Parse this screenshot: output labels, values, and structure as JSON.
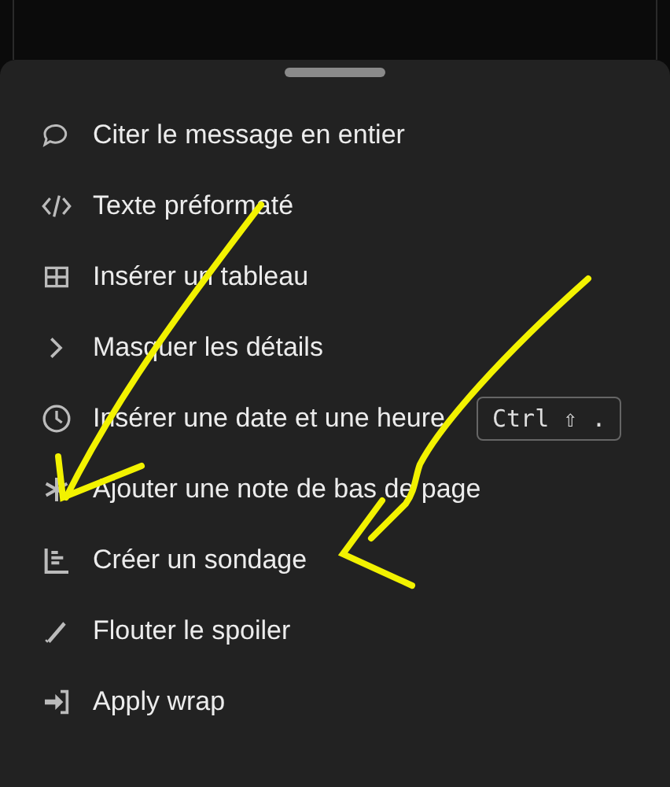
{
  "menu": {
    "items": [
      {
        "label": "Citer le message en entier"
      },
      {
        "label": "Texte préformaté"
      },
      {
        "label": "Insérer un tableau"
      },
      {
        "label": "Masquer les détails"
      },
      {
        "label": "Insérer une date et une heure",
        "shortcut": "Ctrl ⇧ ."
      },
      {
        "label": "Ajouter une note de bas de page"
      },
      {
        "label": "Créer un sondage"
      },
      {
        "label": "Flouter le spoiler"
      },
      {
        "label": "Apply wrap"
      }
    ]
  }
}
